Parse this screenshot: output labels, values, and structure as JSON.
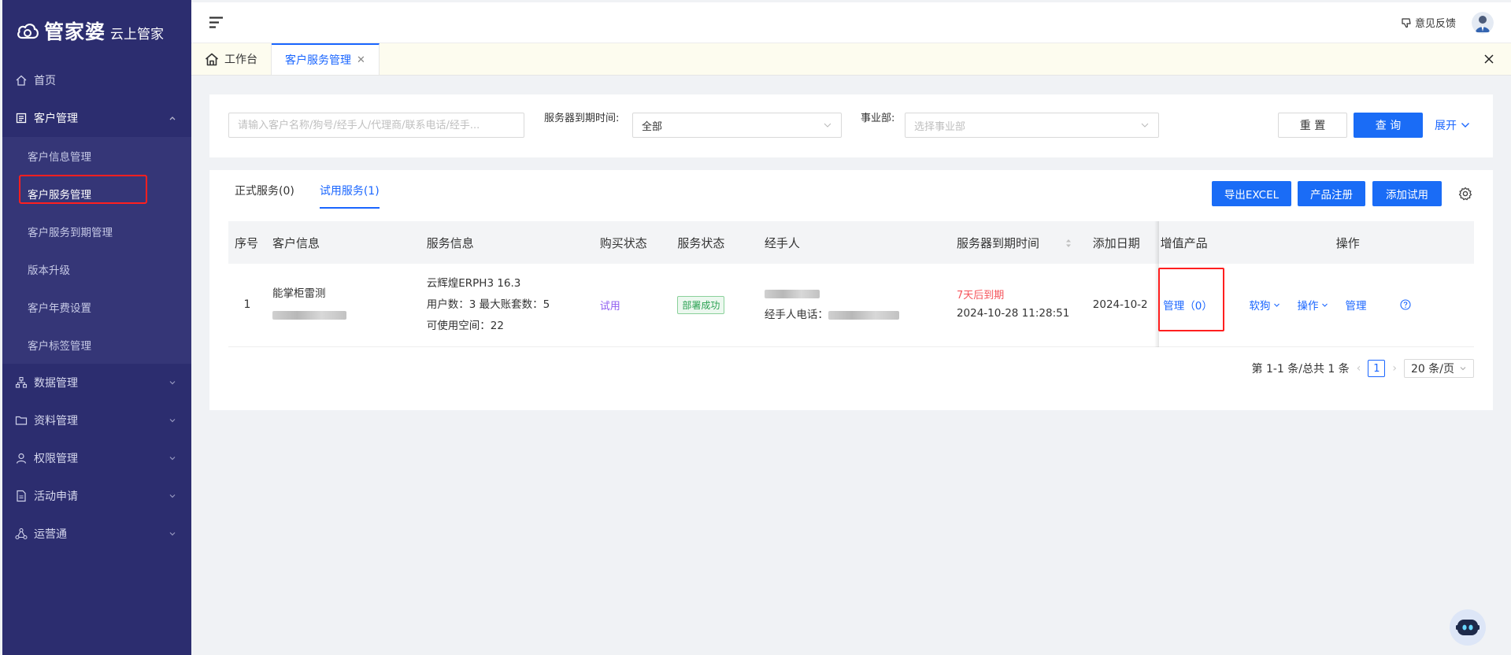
{
  "brand": {
    "name": "管家婆",
    "sub": "云上管家"
  },
  "sidebar": {
    "home": "首页",
    "customer_mgmt": {
      "label": "客户管理",
      "items": [
        {
          "label": "客户信息管理"
        },
        {
          "label": "客户服务管理"
        },
        {
          "label": "客户服务到期管理"
        },
        {
          "label": "版本升级"
        },
        {
          "label": "客户年费设置"
        },
        {
          "label": "客户标签管理"
        }
      ]
    },
    "groups": [
      {
        "label": "数据管理",
        "icon": "org-icon"
      },
      {
        "label": "资料管理",
        "icon": "folder-icon"
      },
      {
        "label": "权限管理",
        "icon": "user-icon"
      },
      {
        "label": "活动申请",
        "icon": "document-icon"
      },
      {
        "label": "运营通",
        "icon": "network-icon"
      }
    ]
  },
  "topbar": {
    "feedback": "意见反馈"
  },
  "tabs": {
    "home": "工作台",
    "active": "客户服务管理"
  },
  "search": {
    "keyword_placeholder": "请输入客户名称/狗号/经手人/代理商/联系电话/经手...",
    "expire_label": "服务器到期时间:",
    "expire_value": "全部",
    "dept_label": "事业部:",
    "dept_placeholder": "选择事业部",
    "reset": "重 置",
    "query": "查 询",
    "expand": "展开"
  },
  "list": {
    "tabs": [
      "正式服务(0)",
      "试用服务(1)"
    ],
    "buttons": {
      "export": "导出EXCEL",
      "register": "产品注册",
      "add_trial": "添加试用"
    },
    "columns": {
      "index": "序号",
      "customer": "客户信息",
      "service": "服务信息",
      "buy_status": "购买状态",
      "service_status": "服务状态",
      "handler": "经手人",
      "expire": "服务器到期时间",
      "added": "添加日期",
      "value_added": "增值产品",
      "ops": "操作"
    },
    "row": {
      "index": "1",
      "customer_name": "能掌柜雷测",
      "service_line1": "云辉煌ERPH3 16.3",
      "service_line2": "用户数：3 最大账套数：5",
      "service_line3": "可使用空间：22",
      "buy_status": "试用",
      "service_status": "部署成功",
      "handler_phone_label": "经手人电话：",
      "expire_warn": "7天后到期",
      "expire_time": "2024-10-28 11:28:51",
      "added_date": "2024-10-2",
      "value_added": "管理（0）",
      "op_softdog": "软狗",
      "op_operate": "操作",
      "op_manage": "管理"
    }
  },
  "pagination": {
    "summary": "第 1-1 条/总共 1 条",
    "page": "1",
    "page_size": "20 条/页"
  },
  "colors": {
    "sidebar": "#2c2d6f",
    "primary": "#1a6cf6",
    "highlight": "#ff1f1f",
    "trial": "#8f5cf0",
    "warn": "#f5545b",
    "success": "#2aa152"
  }
}
